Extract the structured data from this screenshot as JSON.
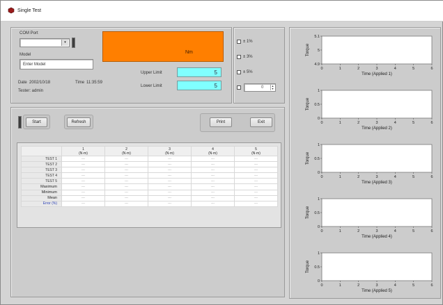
{
  "window": {
    "title": "Single Test"
  },
  "controls": {
    "com_port_label": "COM Port",
    "model_label": "Model",
    "model_value": "Enter Model",
    "date_label": "Date",
    "date_value": "2002/10/18",
    "time_label": "Time",
    "time_value": "11:35:59",
    "tester": "Tester: admin",
    "display_value": "Nm",
    "upper_limit_label": "Upper Limit",
    "upper_limit_value": "5",
    "lower_limit_label": "Lower Limit",
    "lower_limit_value": "5",
    "display_color": "#ff7f00",
    "limit_field_color": "#80ffff"
  },
  "options": {
    "items": [
      "± 1%",
      "± 3%",
      "± 5%"
    ],
    "custom_value": "0"
  },
  "buttons": {
    "start": "Start",
    "refresh": "Refresh",
    "print": "Print",
    "exit": "Exit"
  },
  "results": {
    "columns": [
      {
        "num": "1",
        "unit": "(N·m)"
      },
      {
        "num": "2",
        "unit": "(N·m)"
      },
      {
        "num": "3",
        "unit": "(N·m)"
      },
      {
        "num": "4",
        "unit": "(N·m)"
      },
      {
        "num": "5",
        "unit": "(N·m)"
      }
    ],
    "rows": [
      "TEST 1",
      "TEST 2",
      "TEST 3",
      "TEST 4",
      "TEST 5",
      "Maximum",
      "Minimum",
      "Mean",
      "Error (%)"
    ],
    "placeholder": "---"
  },
  "chart_data": [
    {
      "type": "line",
      "xlabel": "Time (Applied 1)",
      "ylabel": "Torque",
      "xlim": [
        0,
        6
      ],
      "ylim": [
        4.9,
        5.1
      ],
      "xticks": [
        "0",
        "1",
        "2",
        "3",
        "4",
        "5",
        "6"
      ],
      "yticks": [
        "4.9",
        "5",
        "5.1"
      ],
      "series": []
    },
    {
      "type": "line",
      "xlabel": "Time (Applied 2)",
      "ylabel": "Torque",
      "xlim": [
        0,
        6
      ],
      "ylim": [
        0,
        1
      ],
      "xticks": [
        "0",
        "1",
        "2",
        "3",
        "4",
        "5",
        "6"
      ],
      "yticks": [
        "0",
        "0.5",
        "1"
      ],
      "series": []
    },
    {
      "type": "line",
      "xlabel": "Time (Applied 3)",
      "ylabel": "Torque",
      "xlim": [
        0,
        6
      ],
      "ylim": [
        0,
        1
      ],
      "xticks": [
        "0",
        "1",
        "2",
        "3",
        "4",
        "5",
        "6"
      ],
      "yticks": [
        "0",
        "0.5",
        "1"
      ],
      "series": []
    },
    {
      "type": "line",
      "xlabel": "Time (Applied 4)",
      "ylabel": "Torque",
      "xlim": [
        0,
        6
      ],
      "ylim": [
        0,
        1
      ],
      "xticks": [
        "0",
        "1",
        "2",
        "3",
        "4",
        "5",
        "6"
      ],
      "yticks": [
        "0",
        "0.5",
        "1"
      ],
      "series": []
    },
    {
      "type": "line",
      "xlabel": "Time (Applied 5)",
      "ylabel": "Torque",
      "xlim": [
        0,
        6
      ],
      "ylim": [
        0,
        1
      ],
      "xticks": [
        "0",
        "1",
        "2",
        "3",
        "4",
        "5",
        "6"
      ],
      "yticks": [
        "0",
        "0.5",
        "1"
      ],
      "series": []
    }
  ]
}
